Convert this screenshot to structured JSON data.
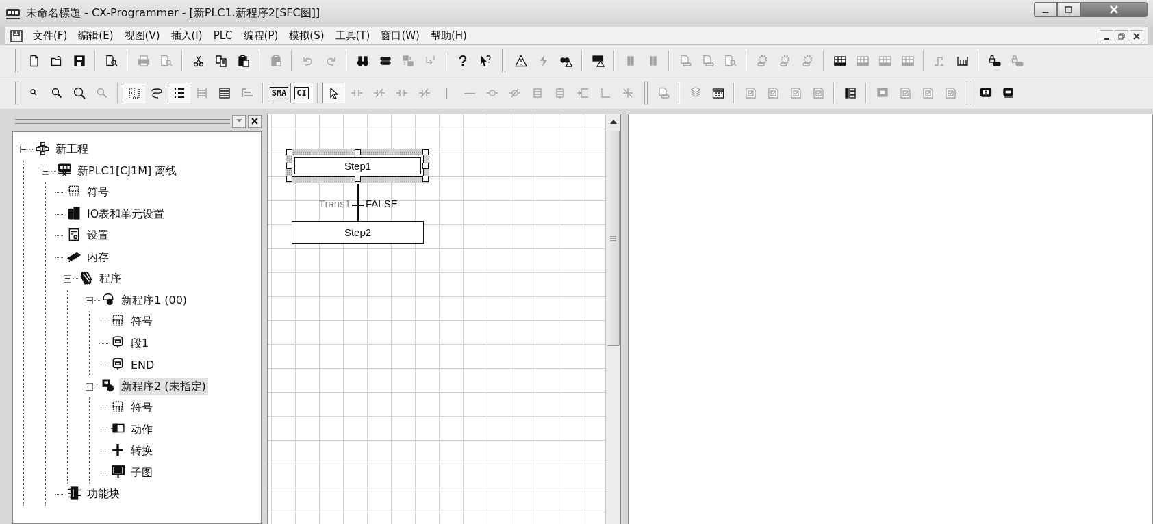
{
  "window": {
    "title": "未命名標題 - CX-Programmer - [新PLC1.新程序2[SFC图]]"
  },
  "menu": [
    "文件(F)",
    "编辑(E)",
    "视图(V)",
    "插入(I)",
    "PLC",
    "编程(P)",
    "模拟(S)",
    "工具(T)",
    "窗口(W)",
    "帮助(H)"
  ],
  "toolbars": [
    {
      "items": [
        {
          "kind": "grip"
        },
        {
          "kind": "button",
          "disabled": false
        },
        {
          "kind": "button",
          "disabled": false
        },
        {
          "kind": "button",
          "disabled": false
        },
        {
          "kind": "separator"
        },
        {
          "kind": "button",
          "disabled": false
        },
        {
          "kind": "separator"
        },
        {
          "kind": "button",
          "disabled": true
        },
        {
          "kind": "button",
          "disabled": true
        },
        {
          "kind": "separator"
        },
        {
          "kind": "button",
          "disabled": false
        },
        {
          "kind": "button",
          "disabled": false
        },
        {
          "kind": "button",
          "disabled": false
        },
        {
          "kind": "separator"
        },
        {
          "kind": "button",
          "disabled": true
        },
        {
          "kind": "separator"
        },
        {
          "kind": "button",
          "disabled": true
        },
        {
          "kind": "button",
          "disabled": true
        },
        {
          "kind": "separator"
        },
        {
          "kind": "button",
          "disabled": false
        },
        {
          "kind": "button",
          "disabled": false
        },
        {
          "kind": "button",
          "disabled": true
        },
        {
          "kind": "button",
          "disabled": true
        },
        {
          "kind": "separator"
        },
        {
          "kind": "button",
          "disabled": false
        },
        {
          "kind": "button",
          "disabled": false
        },
        {
          "kind": "grip"
        },
        {
          "kind": "button",
          "disabled": false
        },
        {
          "kind": "button",
          "disabled": true
        },
        {
          "kind": "button",
          "disabled": false
        },
        {
          "kind": "separator"
        },
        {
          "kind": "button",
          "disabled": false
        },
        {
          "kind": "separator"
        },
        {
          "kind": "button",
          "disabled": true
        },
        {
          "kind": "button",
          "disabled": true
        },
        {
          "kind": "separator"
        },
        {
          "kind": "button",
          "disabled": true
        },
        {
          "kind": "button",
          "disabled": true
        },
        {
          "kind": "button",
          "disabled": true
        },
        {
          "kind": "separator"
        },
        {
          "kind": "button",
          "disabled": true
        },
        {
          "kind": "button",
          "disabled": true
        },
        {
          "kind": "button",
          "disabled": true
        },
        {
          "kind": "separator"
        },
        {
          "kind": "button",
          "disabled": false
        },
        {
          "kind": "button",
          "disabled": true
        },
        {
          "kind": "button",
          "disabled": true
        },
        {
          "kind": "button",
          "disabled": true
        },
        {
          "kind": "separator"
        },
        {
          "kind": "button",
          "disabled": true
        },
        {
          "kind": "button",
          "disabled": false
        },
        {
          "kind": "separator"
        },
        {
          "kind": "button",
          "disabled": false
        },
        {
          "kind": "button",
          "disabled": true
        }
      ]
    },
    {
      "items": [
        {
          "kind": "grip"
        },
        {
          "kind": "button",
          "disabled": false,
          "pressed": false
        },
        {
          "kind": "button",
          "disabled": false,
          "pressed": false
        },
        {
          "kind": "button",
          "disabled": false,
          "pressed": false
        },
        {
          "kind": "button",
          "disabled": true,
          "pressed": false
        },
        {
          "kind": "separator"
        },
        {
          "kind": "button",
          "disabled": false,
          "pressed": true
        },
        {
          "kind": "button",
          "disabled": false,
          "pressed": false
        },
        {
          "kind": "button",
          "disabled": false,
          "pressed": true
        },
        {
          "kind": "button",
          "disabled": true,
          "pressed": false
        },
        {
          "kind": "button",
          "disabled": false,
          "pressed": false
        },
        {
          "kind": "button",
          "disabled": true,
          "pressed": false
        },
        {
          "kind": "separator"
        },
        {
          "kind": "button",
          "label": "SMA",
          "disabled": false,
          "pressed": false
        },
        {
          "kind": "button",
          "label": "CI",
          "disabled": false,
          "pressed": true
        },
        {
          "kind": "separator"
        },
        {
          "kind": "button",
          "disabled": false,
          "pressed": true
        },
        {
          "kind": "button",
          "disabled": true,
          "pressed": false
        },
        {
          "kind": "button",
          "disabled": true,
          "pressed": false
        },
        {
          "kind": "button",
          "disabled": true,
          "pressed": false
        },
        {
          "kind": "button",
          "disabled": true,
          "pressed": false
        },
        {
          "kind": "button",
          "disabled": true,
          "pressed": false
        },
        {
          "kind": "button",
          "disabled": true,
          "pressed": false
        },
        {
          "kind": "button",
          "disabled": true,
          "pressed": false
        },
        {
          "kind": "button",
          "disabled": true,
          "pressed": false
        },
        {
          "kind": "button",
          "disabled": true,
          "pressed": false
        },
        {
          "kind": "button",
          "disabled": true,
          "pressed": false
        },
        {
          "kind": "button",
          "disabled": true,
          "pressed": false
        },
        {
          "kind": "button",
          "disabled": true,
          "pressed": false
        },
        {
          "kind": "button",
          "disabled": true,
          "pressed": false
        },
        {
          "kind": "grip"
        },
        {
          "kind": "button",
          "disabled": true,
          "pressed": false
        },
        {
          "kind": "separator"
        },
        {
          "kind": "button",
          "disabled": true,
          "pressed": false
        },
        {
          "kind": "button",
          "disabled": false,
          "pressed": false
        },
        {
          "kind": "separator"
        },
        {
          "kind": "button",
          "disabled": true,
          "pressed": false
        },
        {
          "kind": "button",
          "disabled": true,
          "pressed": false
        },
        {
          "kind": "button",
          "disabled": true,
          "pressed": false
        },
        {
          "kind": "button",
          "disabled": true,
          "pressed": false
        },
        {
          "kind": "separator"
        },
        {
          "kind": "button",
          "disabled": false,
          "pressed": false
        },
        {
          "kind": "separator"
        },
        {
          "kind": "button",
          "disabled": true,
          "pressed": false
        },
        {
          "kind": "button",
          "disabled": true,
          "pressed": false
        },
        {
          "kind": "button",
          "disabled": true,
          "pressed": false
        },
        {
          "kind": "button",
          "disabled": true,
          "pressed": false
        },
        {
          "kind": "grip"
        },
        {
          "kind": "button",
          "disabled": false,
          "pressed": false
        },
        {
          "kind": "button",
          "disabled": false,
          "pressed": false
        }
      ]
    }
  ],
  "tree": [
    {
      "label": "新工程",
      "kind": "project",
      "expanded": true,
      "selected": false,
      "children": [
        {
          "label": "新PLC1[CJ1M] 离线",
          "kind": "plc",
          "expanded": true,
          "selected": false,
          "children": [
            {
              "label": "符号",
              "kind": "symbols",
              "selected": false
            },
            {
              "label": "IO表和单元设置",
              "kind": "io-table",
              "selected": false
            },
            {
              "label": "设置",
              "kind": "settings",
              "selected": false
            },
            {
              "label": "内存",
              "kind": "memory",
              "selected": false
            },
            {
              "label": "程序",
              "kind": "programs",
              "expanded": true,
              "selected": false,
              "children": [
                {
                  "label": "新程序1 (00)",
                  "kind": "program",
                  "expanded": true,
                  "selected": false,
                  "children": [
                    {
                      "label": "符号",
                      "kind": "symbols",
                      "selected": false
                    },
                    {
                      "label": "段1",
                      "kind": "section",
                      "selected": false
                    },
                    {
                      "label": "END",
                      "kind": "section",
                      "selected": false
                    }
                  ]
                },
                {
                  "label": "新程序2 (未指定)",
                  "kind": "sfc-program",
                  "expanded": true,
                  "selected": true,
                  "children": [
                    {
                      "label": "符号",
                      "kind": "symbols",
                      "selected": false
                    },
                    {
                      "label": "动作",
                      "kind": "action",
                      "selected": false
                    },
                    {
                      "label": "转换",
                      "kind": "transition",
                      "selected": false
                    },
                    {
                      "label": "子图",
                      "kind": "subchart",
                      "selected": false
                    }
                  ]
                }
              ]
            },
            {
              "label": "功能块",
              "kind": "function-blocks",
              "selected": false
            }
          ]
        }
      ]
    }
  ],
  "sfc": {
    "steps": [
      {
        "name": "Step1",
        "selected": true
      },
      {
        "name": "Step2",
        "selected": false
      }
    ],
    "transitions": [
      {
        "name": "Trans1",
        "condition": "FALSE"
      }
    ]
  }
}
